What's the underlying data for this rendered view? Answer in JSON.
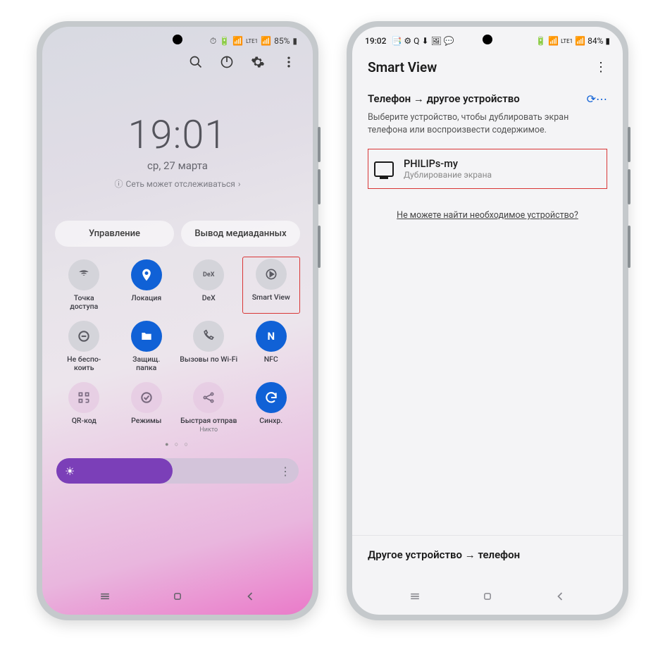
{
  "left": {
    "status": {
      "battery": "85%",
      "lte": "LTE1"
    },
    "clock": {
      "time": "19:01",
      "date": "ср, 27 марта",
      "info": "Сеть может отслеживаться"
    },
    "pills": {
      "control": "Управление",
      "media": "Вывод медиаданных"
    },
    "tiles": [
      {
        "label": "Точка\nдоступа"
      },
      {
        "label": "Локация"
      },
      {
        "label": "DeX"
      },
      {
        "label": "Smart View"
      },
      {
        "label": "Не беспо-\nкоить"
      },
      {
        "label": "Защищ.\nпапка"
      },
      {
        "label": "Вызовы по Wi-Fi"
      },
      {
        "label": "NFC"
      },
      {
        "label": "QR-код"
      },
      {
        "label": "Режимы"
      },
      {
        "label": "Быстрая отправ",
        "sub": "Никто"
      },
      {
        "label": "Синхр."
      }
    ]
  },
  "right": {
    "status": {
      "time": "19:02",
      "battery": "84%",
      "lte": "LTE1"
    },
    "header": "Smart View",
    "section1": {
      "title": "Телефон → другое устройство",
      "desc": "Выберите устройство, чтобы дублировать экран телефона или воспроизвести содержимое."
    },
    "device": {
      "name": "PHILIPs-my",
      "sub": "Дублирование экрана"
    },
    "cant_find": "Не можете найти необходимое устройство?",
    "section2": "Другое устройство → телефон"
  }
}
